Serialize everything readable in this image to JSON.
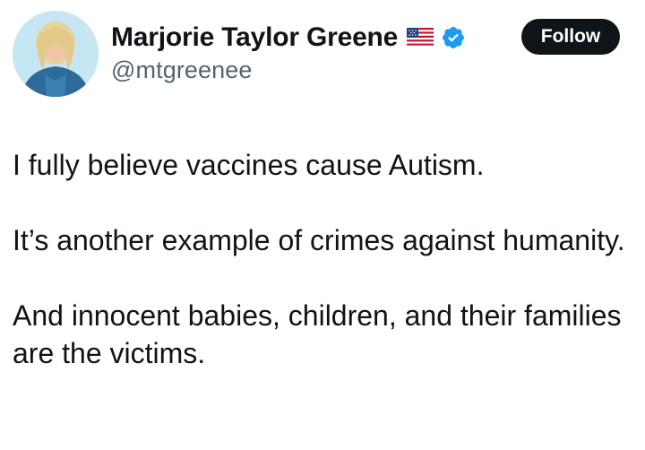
{
  "author": {
    "display_name": "Marjorie Taylor Greene",
    "handle": "@mtgreenee",
    "badges": [
      "us-flag-icon",
      "verified-checkmark-icon"
    ],
    "verified_color": "#1d9bf0"
  },
  "follow_button": {
    "label": "Follow"
  },
  "tweet": {
    "paragraphs": [
      "I fully believe vaccines cause Autism.",
      "It’s another example of crimes against humanity.",
      "And innocent babies, children, and their families are the victims."
    ]
  }
}
